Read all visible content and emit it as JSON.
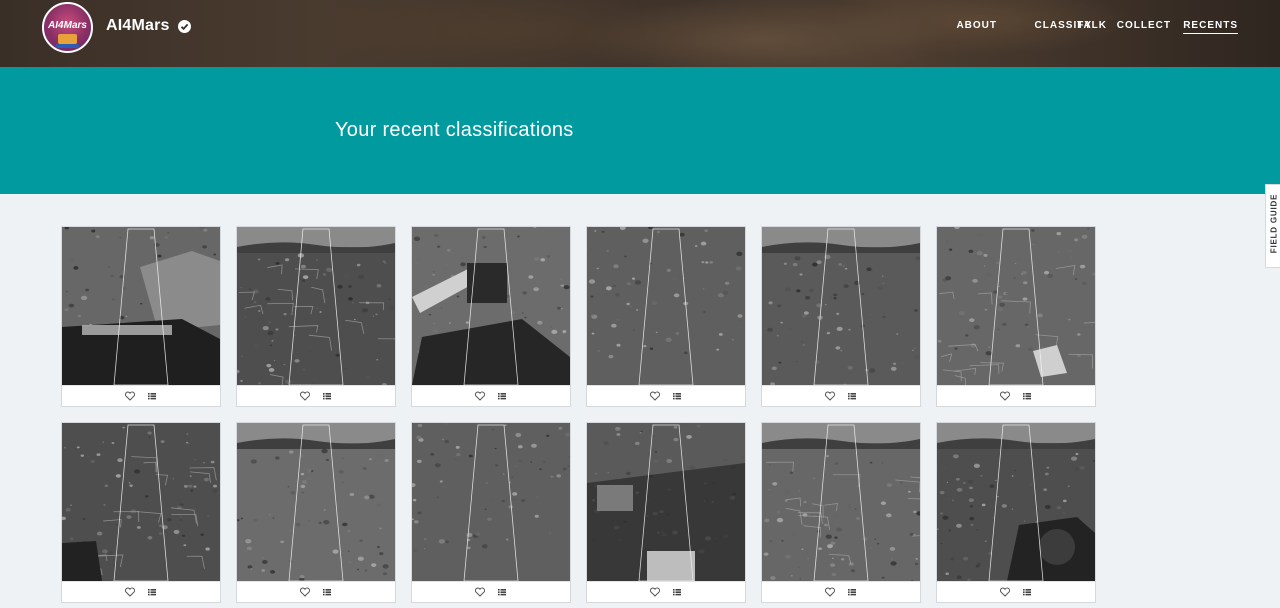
{
  "header": {
    "brand": "AI4Mars",
    "logo_text": "AI4Mars",
    "nav": [
      {
        "label": "ABOUT",
        "active": false
      },
      {
        "label": "CLASSIFY",
        "active": false
      },
      {
        "label": "TALK",
        "active": false
      },
      {
        "label": "COLLECT",
        "active": false
      },
      {
        "label": "RECENTS",
        "active": true
      }
    ]
  },
  "banner": {
    "title": "Your recent classifications"
  },
  "field_guide": {
    "label": "FIELD GUIDE"
  },
  "colors": {
    "teal": "#009a9f",
    "page_bg": "#eff2f5"
  },
  "card_actions": {
    "favorite_icon": "heart-icon",
    "collect_icon": "list-icon"
  },
  "recents": [
    {
      "scene": "rover-deck-rock"
    },
    {
      "scene": "plain-horizon"
    },
    {
      "scene": "robotic-arm"
    },
    {
      "scene": "pebbly-ground"
    },
    {
      "scene": "plain-with-ridge"
    },
    {
      "scene": "bedrock-slabs"
    },
    {
      "scene": "cracked-bedrock"
    },
    {
      "scene": "plain-with-hills"
    },
    {
      "scene": "pebbly-ground"
    },
    {
      "scene": "rover-shadow"
    },
    {
      "scene": "rocky-ground"
    },
    {
      "scene": "rover-wheel-gravel"
    }
  ]
}
